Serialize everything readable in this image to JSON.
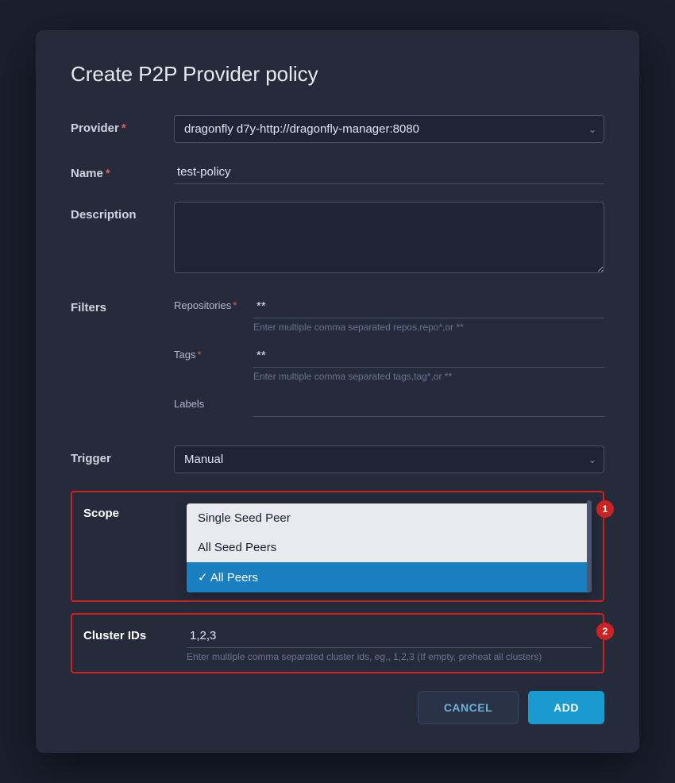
{
  "dialog": {
    "title": "Create P2P Provider policy"
  },
  "form": {
    "provider_label": "Provider",
    "provider_required": true,
    "provider_value": "dragonfly d7y-http://dragonfly-manager:8080",
    "name_label": "Name",
    "name_required": true,
    "name_value": "test-policy",
    "description_label": "Description",
    "description_value": "",
    "description_placeholder": "",
    "filters_label": "Filters",
    "repositories_label": "Repositories",
    "repositories_required": true,
    "repositories_value": "**",
    "repositories_hint": "Enter multiple comma separated repos,repo*,or **",
    "tags_label": "Tags",
    "tags_required": true,
    "tags_value": "**",
    "tags_hint": "Enter multiple comma separated tags,tag*,or **",
    "labels_label": "Labels",
    "labels_value": "",
    "trigger_label": "Trigger",
    "trigger_value": "Manual",
    "scope_label": "Scope",
    "scope_dropdown": {
      "options": [
        {
          "label": "Single Seed Peer",
          "selected": false
        },
        {
          "label": "All Seed Peers",
          "selected": false
        },
        {
          "label": "All Peers",
          "selected": true
        }
      ]
    },
    "cluster_ids_label": "Cluster IDs",
    "cluster_ids_value": "1,2,3",
    "cluster_ids_hint": "Enter multiple comma separated cluster ids, eg., 1,2,3 (If empty, preheat all clusters)",
    "cancel_label": "CANCEL",
    "add_label": "ADD"
  },
  "badges": {
    "scope_badge": "1",
    "cluster_badge": "2"
  }
}
